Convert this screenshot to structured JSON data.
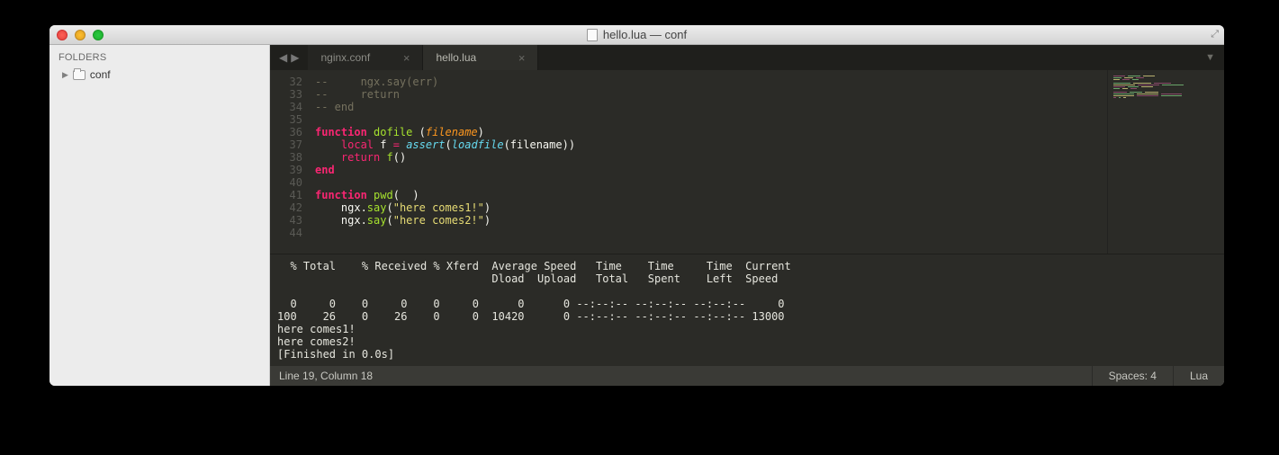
{
  "window_title": "hello.lua — conf",
  "sidebar": {
    "header": "FOLDERS",
    "items": [
      {
        "label": "conf"
      }
    ]
  },
  "tabs": [
    {
      "label": "nginx.conf",
      "active": false
    },
    {
      "label": "hello.lua",
      "active": true
    }
  ],
  "editor": {
    "first_line": 32,
    "lines": [
      {
        "n": 32,
        "tokens": [
          {
            "c": "c-comment",
            "t": "--     ngx.say(err)"
          }
        ]
      },
      {
        "n": 33,
        "tokens": [
          {
            "c": "c-comment",
            "t": "--     return"
          }
        ]
      },
      {
        "n": 34,
        "tokens": [
          {
            "c": "c-comment",
            "t": "-- end"
          }
        ]
      },
      {
        "n": 35,
        "tokens": []
      },
      {
        "n": 36,
        "tokens": [
          {
            "c": "c-kw",
            "t": "function"
          },
          {
            "c": "c-plain",
            "t": " "
          },
          {
            "c": "c-fn-def",
            "t": "dofile"
          },
          {
            "c": "c-plain",
            "t": " ("
          },
          {
            "c": "c-param",
            "t": "filename"
          },
          {
            "c": "c-plain",
            "t": ")"
          }
        ]
      },
      {
        "n": 37,
        "tokens": [
          {
            "c": "c-plain",
            "t": "    "
          },
          {
            "c": "c-kw2",
            "t": "local"
          },
          {
            "c": "c-plain",
            "t": " f "
          },
          {
            "c": "c-kw2",
            "t": "="
          },
          {
            "c": "c-plain",
            "t": " "
          },
          {
            "c": "c-builtin",
            "t": "assert"
          },
          {
            "c": "c-plain",
            "t": "("
          },
          {
            "c": "c-builtin",
            "t": "loadfile"
          },
          {
            "c": "c-plain",
            "t": "(filename))"
          }
        ]
      },
      {
        "n": 38,
        "tokens": [
          {
            "c": "c-plain",
            "t": "    "
          },
          {
            "c": "c-kw2",
            "t": "return"
          },
          {
            "c": "c-plain",
            "t": " "
          },
          {
            "c": "c-fn",
            "t": "f"
          },
          {
            "c": "c-plain",
            "t": "()"
          }
        ]
      },
      {
        "n": 39,
        "tokens": [
          {
            "c": "c-kw",
            "t": "end"
          }
        ]
      },
      {
        "n": 40,
        "tokens": []
      },
      {
        "n": 41,
        "tokens": [
          {
            "c": "c-kw",
            "t": "function"
          },
          {
            "c": "c-plain",
            "t": " "
          },
          {
            "c": "c-fn-def",
            "t": "pwd"
          },
          {
            "c": "c-plain",
            "t": "(  )"
          }
        ]
      },
      {
        "n": 42,
        "tokens": [
          {
            "c": "c-plain",
            "t": "    ngx."
          },
          {
            "c": "c-fn",
            "t": "say"
          },
          {
            "c": "c-plain",
            "t": "("
          },
          {
            "c": "c-str",
            "t": "\"here comes1!\""
          },
          {
            "c": "c-plain",
            "t": ")"
          }
        ]
      },
      {
        "n": 43,
        "tokens": [
          {
            "c": "c-plain",
            "t": "    ngx."
          },
          {
            "c": "c-fn",
            "t": "say"
          },
          {
            "c": "c-plain",
            "t": "("
          },
          {
            "c": "c-str",
            "t": "\"here comes2!\""
          },
          {
            "c": "c-plain",
            "t": ")"
          }
        ]
      },
      {
        "n": 44,
        "tokens": []
      }
    ]
  },
  "console": {
    "lines": [
      "  % Total    % Received % Xferd  Average Speed   Time    Time     Time  Current",
      "                                 Dload  Upload   Total   Spent    Left  Speed",
      "",
      "  0     0    0     0    0     0      0      0 --:--:-- --:--:-- --:--:--     0",
      "100    26    0    26    0     0  10420      0 --:--:-- --:--:-- --:--:-- 13000",
      "here comes1!",
      "here comes2!",
      "[Finished in 0.0s]"
    ]
  },
  "statusbar": {
    "left": "Line 19, Column 18",
    "spaces": "Spaces: 4",
    "syntax": "Lua"
  }
}
